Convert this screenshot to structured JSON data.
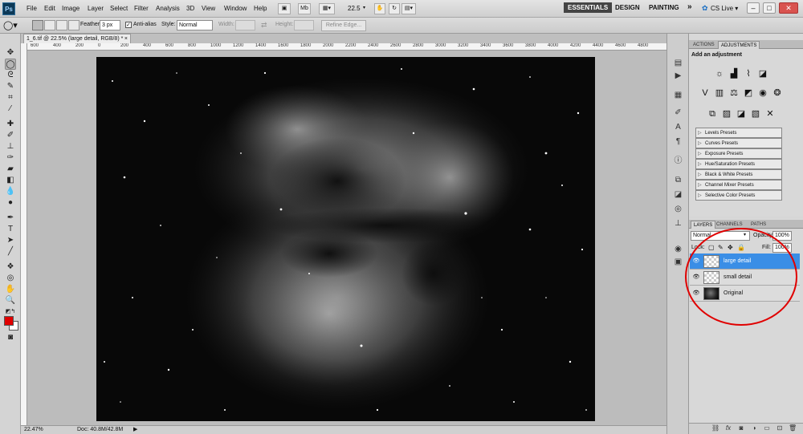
{
  "app": {
    "logo": "Ps"
  },
  "menubar": {
    "items": [
      "File",
      "Edit",
      "Image",
      "Layer",
      "Select",
      "Filter",
      "Analysis",
      "3D",
      "View",
      "Window",
      "Help"
    ],
    "zoom": "22.5",
    "mb_label": "Mb",
    "workspaces": {
      "essentials": "ESSENTIALS",
      "design": "DESIGN",
      "painting": "PAINTING",
      "more": "»"
    },
    "cs_live": "CS Live ▾",
    "window_buttons": {
      "minimize": "–",
      "restore": "□",
      "close": "✕"
    }
  },
  "options": {
    "feather_label": "Feather:",
    "feather_value": "3 px",
    "antialias_label": "Anti-alias",
    "style_label": "Style:",
    "style_value": "Normal",
    "width_label": "Width:",
    "height_label": "Height:",
    "refine_edge": "Refine Edge..."
  },
  "document": {
    "tab_title": "1_6.tif @ 22.5% (large detail, RGB/8) *",
    "tab_close": "×",
    "ruler_labels": [
      "600",
      "400",
      "200",
      "0",
      "200",
      "400",
      "600",
      "800",
      "1000",
      "1200",
      "1400",
      "1600",
      "1800",
      "2000",
      "2200",
      "2400",
      "2600",
      "2800",
      "3000",
      "3200",
      "3400",
      "3600",
      "3800",
      "4000",
      "4200",
      "4400",
      "4600",
      "4800"
    ]
  },
  "status": {
    "zoom": "22.47%",
    "doc": "Doc: 40.8M/42.8M"
  },
  "panels": {
    "adjust_tabs": {
      "actions": "ACTIONS",
      "adjustments": "ADJUSTMENTS"
    },
    "add_adjustment": "Add an adjustment",
    "presets": [
      "Levels Presets",
      "Curves Presets",
      "Exposure Presets",
      "Hue/Saturation Presets",
      "Black & White Presets",
      "Channel Mixer Presets",
      "Selective Color Presets"
    ],
    "layer_tabs": {
      "layers": "LAYERS",
      "channels": "CHANNELS",
      "paths": "PATHS"
    },
    "blend_mode": "Normal",
    "opacity_label": "Opacity:",
    "opacity_value": "100%",
    "lock_label": "Lock:",
    "fill_label": "Fill:",
    "fill_value": "100%",
    "layers": [
      {
        "name": "large detail"
      },
      {
        "name": "small detail"
      },
      {
        "name": "Original"
      }
    ]
  },
  "colors": {
    "foreground": "#e00000",
    "background": "#ffffff",
    "selection": "#3a8ee6",
    "annotation": "#e00000"
  }
}
